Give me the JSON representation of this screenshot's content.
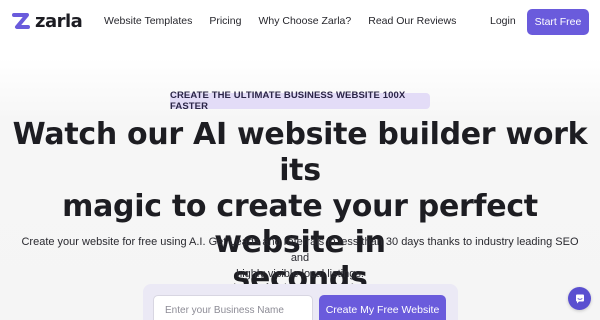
{
  "brand": {
    "name": "zarla",
    "accent": "#6a5bdc"
  },
  "nav": {
    "links": [
      "Website Templates",
      "Pricing",
      "Why Choose Zarla?",
      "Read Our Reviews"
    ],
    "login": "Login",
    "cta": "Start Free"
  },
  "hero": {
    "eyebrow": "CREATE THE ULTIMATE BUSINESS WEBSITE 100X FASTER",
    "headline_lines": [
      "Watch our AI website builder work its",
      "magic to create your perfect website in",
      "seconds"
    ],
    "subtext_lines": [
      "Create your website for free using A.I. Get Leads and referrals in less than 30 days thanks to industry leading SEO and",
      "highly visible local listings."
    ]
  },
  "form": {
    "business_name_placeholder": "Enter your Business Name",
    "business_name_value": "",
    "submit_label": "Create My Free Website"
  },
  "chat": {
    "icon": "chat-icon"
  }
}
